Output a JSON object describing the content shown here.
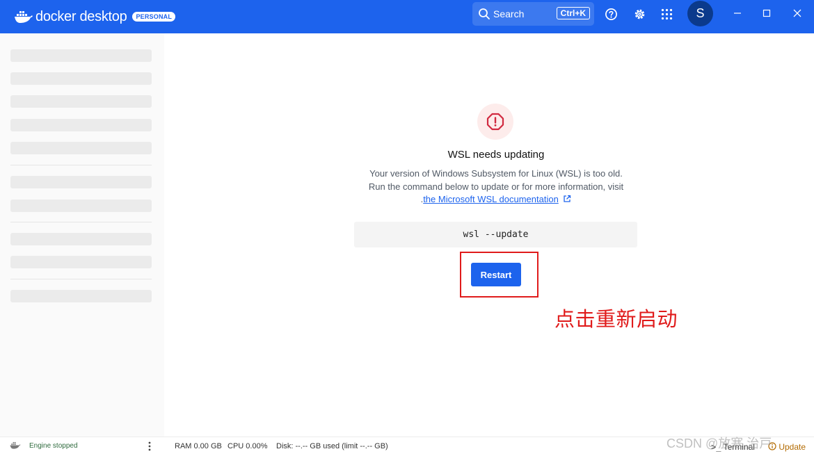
{
  "app": {
    "brand": "docker desktop",
    "badge": "PERSONAL"
  },
  "toolbar": {
    "search_label": "Search",
    "search_shortcut": "Ctrl+K",
    "avatar_initial": "S"
  },
  "dialog": {
    "title": "WSL needs updating",
    "line1": "Your version of Windows Subsystem for Linux (WSL) is too old.",
    "line2": "Run the command below to update or for more information, visit",
    "link_prefix": ".",
    "link_text": "the Microsoft WSL documentation",
    "command": "wsl --update",
    "restart_label": "Restart"
  },
  "annotation": {
    "text": "点击重新启动",
    "color": "#e01b1b"
  },
  "status": {
    "engine": "Engine stopped",
    "ram": "RAM 0.00 GB",
    "cpu": "CPU 0.00%",
    "disk": "Disk: --.-- GB used (limit --.-- GB)",
    "terminal": "Terminal",
    "update": "Update"
  },
  "watermark": "CSDN @放寒 治戸",
  "colors": {
    "accent": "#1d63ed",
    "alert": "#d1293f"
  }
}
